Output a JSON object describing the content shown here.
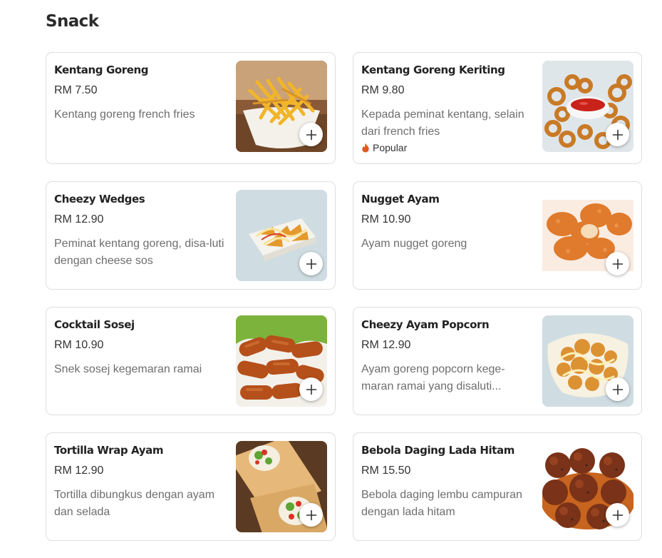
{
  "section": {
    "title": "Snack"
  },
  "items": [
    {
      "name": "Kentang Goreng",
      "price": "RM 7.50",
      "description": "Kentang goreng french fries",
      "badge": ""
    },
    {
      "name": "Kentang Goreng Keriting",
      "price": "RM 9.80",
      "description": "Kepada peminat kentang, selain dari french fries",
      "badge": "Popular"
    },
    {
      "name": "Cheezy Wedges",
      "price": "RM 12.90",
      "description": "Peminat kentang goreng, disa-luti dengan cheese sos",
      "badge": ""
    },
    {
      "name": "Nugget Ayam",
      "price": "RM 10.90",
      "description": "Ayam nugget goreng",
      "badge": ""
    },
    {
      "name": "Cocktail Sosej",
      "price": "RM 10.90",
      "description": "Snek sosej kegemaran ramai",
      "badge": ""
    },
    {
      "name": "Cheezy Ayam Popcorn",
      "price": "RM 12.90",
      "description": "Ayam goreng popcorn kege-maran ramai yang disaluti...",
      "badge": ""
    },
    {
      "name": "Tortilla Wrap Ayam",
      "price": "RM 12.90",
      "description": "Tortilla dibungkus dengan ayam dan selada",
      "badge": ""
    },
    {
      "name": "Bebola Daging Lada Hitam",
      "price": "RM 15.50",
      "description": "Bebola daging lembu campuran dengan lada hitam",
      "badge": ""
    }
  ],
  "colors": {
    "popular_flame": "#e8541e",
    "card_border": "#dedede",
    "description": "#6e6e6e"
  },
  "icons": {
    "add": "plus-icon",
    "popular": "flame-icon"
  }
}
